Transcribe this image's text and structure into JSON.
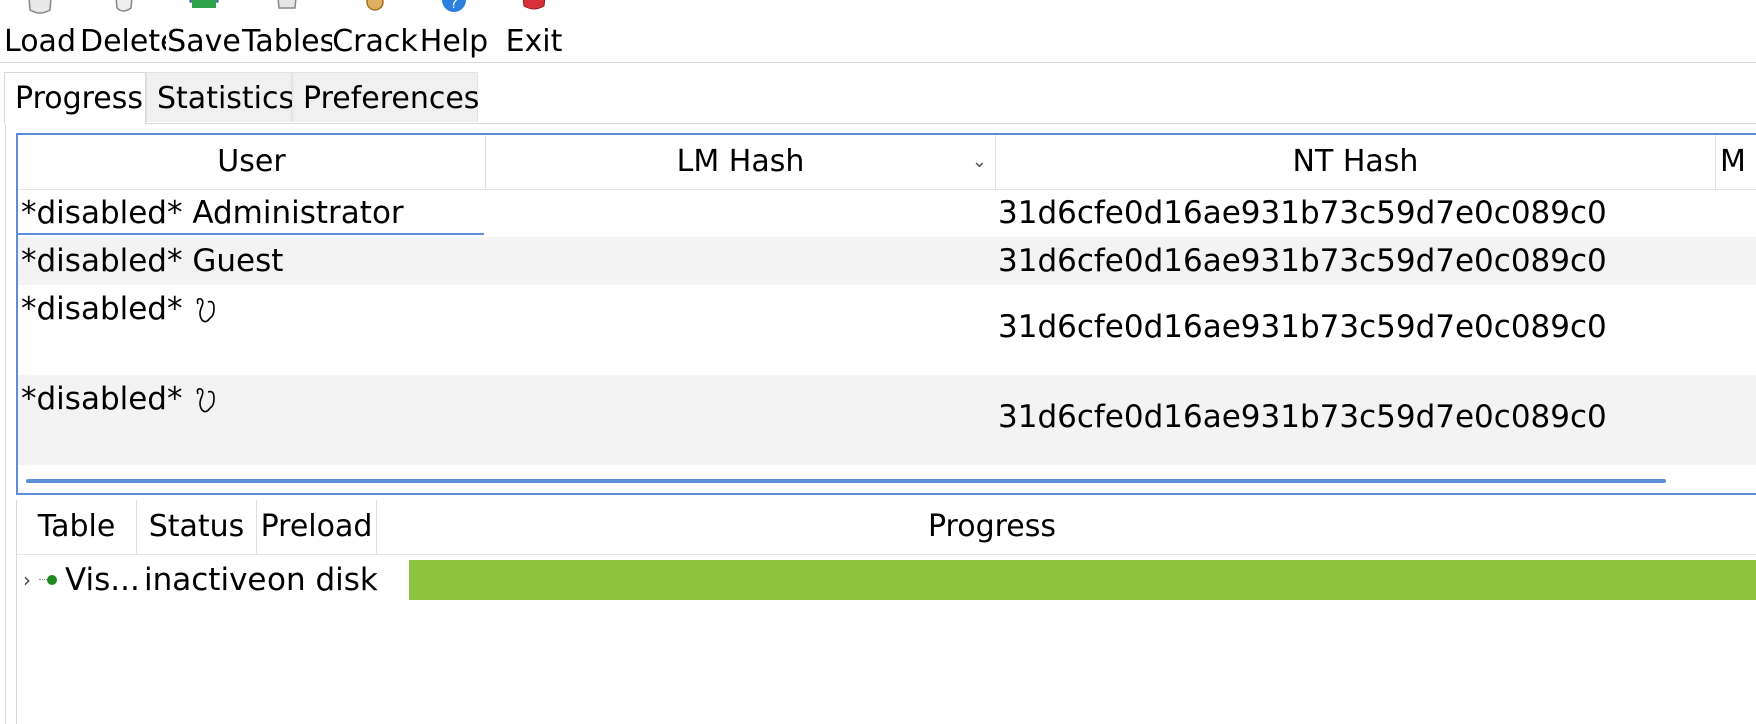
{
  "toolbar": {
    "buttons": [
      {
        "label": "Load",
        "icon": "load-icon"
      },
      {
        "label": "Delete",
        "icon": "delete-icon"
      },
      {
        "label": "Save",
        "icon": "save-icon"
      },
      {
        "label": "Tables",
        "icon": "tables-icon"
      },
      {
        "label": "Crack",
        "icon": "crack-icon"
      },
      {
        "label": "Help",
        "icon": "help-icon"
      },
      {
        "label": "Exit",
        "icon": "exit-icon"
      }
    ]
  },
  "tabs": [
    {
      "label": "Progress",
      "active": true
    },
    {
      "label": "Statistics",
      "active": false
    },
    {
      "label": "Preferences",
      "active": false
    }
  ],
  "hash_table": {
    "columns": [
      "User",
      "LM Hash",
      "NT Hash",
      "M"
    ],
    "rows": [
      {
        "user": "*disabled* Administrator",
        "lm_hash": "",
        "nt_hash": "31d6cfe0d16ae931b73c59d7e0c089c0"
      },
      {
        "user": "*disabled* Guest",
        "lm_hash": "",
        "nt_hash": "31d6cfe0d16ae931b73c59d7e0c089c0"
      },
      {
        "user": "*disabled* ",
        "lm_hash": "",
        "nt_hash": "31d6cfe0d16ae931b73c59d7e0c089c0"
      },
      {
        "user": "*disabled* ",
        "lm_hash": "",
        "nt_hash": "31d6cfe0d16ae931b73c59d7e0c089c0"
      }
    ]
  },
  "tables_list": {
    "columns": [
      "Table",
      "Status",
      "Preload",
      "Progress"
    ],
    "rows": [
      {
        "table": "Vis...",
        "status": "inactive",
        "preload": "on disk",
        "progress_fraction": 1.0
      }
    ]
  },
  "colors": {
    "accent": "#5b8fd9",
    "progress_fill": "#8cc43f",
    "status_dot": "#1e8a1e"
  }
}
